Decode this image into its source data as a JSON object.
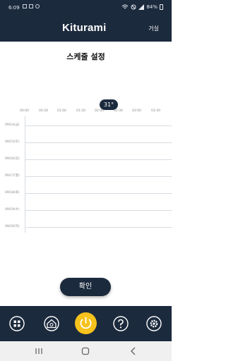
{
  "status": {
    "time": "6:09",
    "battery": "84%"
  },
  "header": {
    "logo_main": "Kiturami",
    "room": "거실"
  },
  "page": {
    "title": "스케줄 설정"
  },
  "schedule": {
    "times": [
      "00:00",
      "00:30",
      "01:00",
      "01:30",
      "02:00",
      "02:30",
      "03:00",
      "03:30"
    ],
    "days": [
      "09/14(금)",
      "09/15(토)",
      "09/16(일)",
      "09/17(월)",
      "09/18(화)",
      "09/19(수)",
      "09/20(목)"
    ],
    "current_temp": "31°"
  },
  "actions": {
    "confirm": "확인"
  },
  "bottom_nav": [
    "grid-icon",
    "home-icon",
    "power-icon",
    "help-icon",
    "gear-icon"
  ]
}
